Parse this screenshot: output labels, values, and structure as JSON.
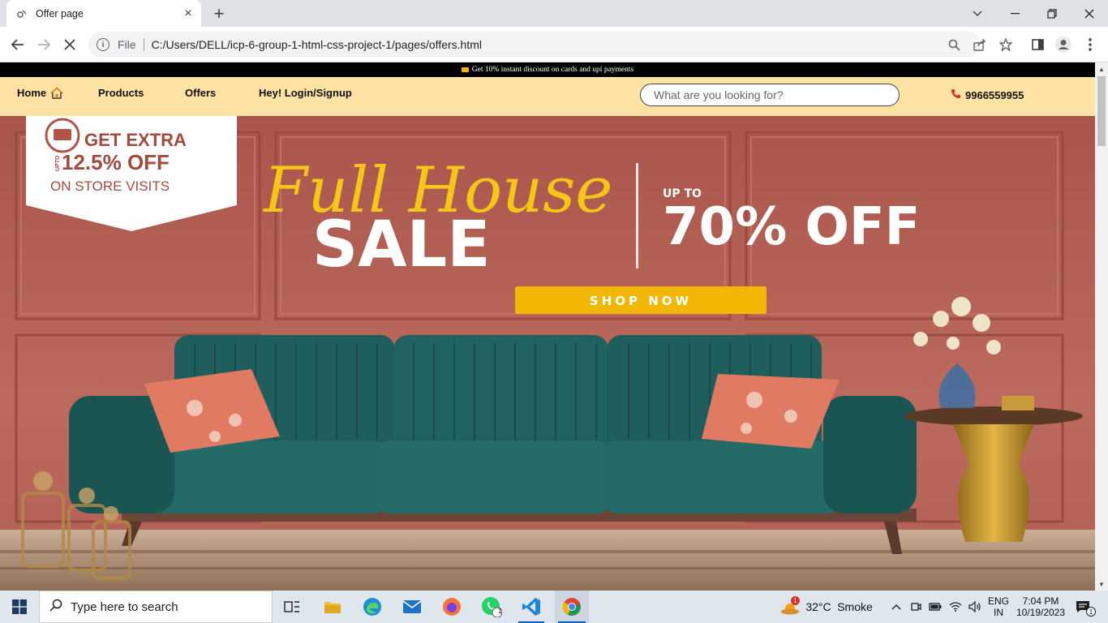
{
  "browser": {
    "tab": {
      "title": "Offer page",
      "close": "×"
    },
    "new_tab": "+",
    "address": {
      "scheme_label": "File",
      "url": "C:/Users/DELL/icp-6-group-1-html-css-project-1/pages/offers.html"
    }
  },
  "page": {
    "promo_text": "Get 10% instant discount on cards and upi payments",
    "nav": {
      "home": "Home",
      "products": "Products",
      "offers": "Offers",
      "login": "Hey! Login/Signup"
    },
    "search": {
      "placeholder": "What are you looking for?"
    },
    "phone": "9966559955",
    "hero": {
      "badge_line1": "GET EXTRA",
      "badge_prefix": "UPTO",
      "badge_line2": "12.5% OFF",
      "badge_line3": "ON STORE VISITS",
      "script_title": "Full House",
      "sale": "SALE",
      "up_to": "UP TO",
      "discount": "70% OFF",
      "cta": "SHOP NOW"
    }
  },
  "taskbar": {
    "search_placeholder": "Type here to search",
    "weather_temp": "32°C",
    "weather_desc": "Smoke",
    "weather_badge": "1",
    "whatsapp_badge": "1",
    "lang_top": "ENG",
    "lang_bottom": "IN",
    "time": "7:04 PM",
    "date": "10/19/2023",
    "notification_count": "1"
  },
  "colors": {
    "promo_bg": "#000000",
    "nav_bg": "#fee3a4",
    "hero_wall": "#b55f53",
    "sofa": "#1f5e5c",
    "cta": "#f2b705",
    "script_yellow": "#f5c518"
  }
}
